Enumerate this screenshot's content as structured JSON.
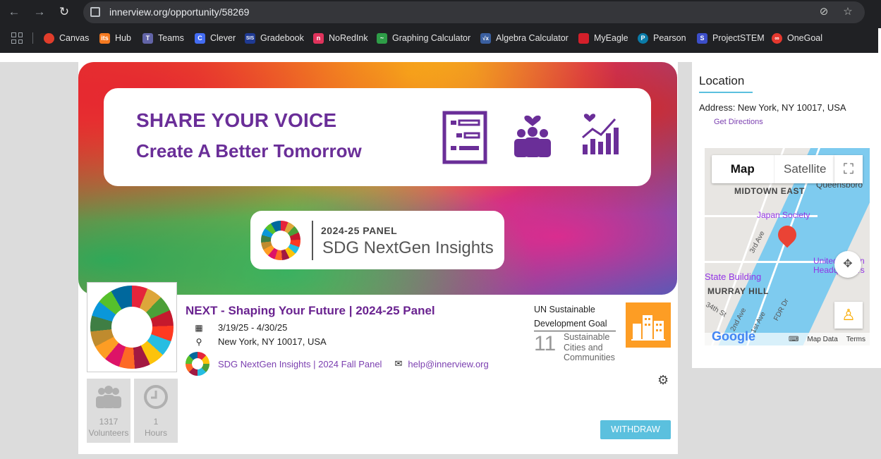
{
  "browser": {
    "url": "innerview.org/opportunity/58269",
    "bookmarks": [
      {
        "label": "Canvas",
        "color": "#e13d2b"
      },
      {
        "label": "Hub",
        "color": "#f47920"
      },
      {
        "label": "Teams",
        "color": "#6264a7"
      },
      {
        "label": "Clever",
        "color": "#436cf2"
      },
      {
        "label": "Gradebook",
        "color": "#1f3a93"
      },
      {
        "label": "NoRedInk",
        "color": "#e0335c"
      },
      {
        "label": "Graphing Calculator",
        "color": "#2e9d47"
      },
      {
        "label": "Algebra Calculator",
        "color": "#3a5f9f"
      },
      {
        "label": "MyEagle",
        "color": "#d41f2a"
      },
      {
        "label": "Pearson",
        "color": "#0a7ba8"
      },
      {
        "label": "ProjectSTEM",
        "color": "#3c4ec9"
      },
      {
        "label": "OneGoal",
        "color": "#e5382e"
      }
    ]
  },
  "banner": {
    "line1": "SHARE YOUR VOICE",
    "line2": "Create A Better Tomorrow",
    "panel_year": "2024-25  PANEL",
    "panel_name": "SDG NextGen Insights"
  },
  "opportunity": {
    "title": "NEXT - Shaping Your Future | 2024-25 Panel",
    "dates": "3/19/25 - 4/30/25",
    "location": "New York, NY 10017, USA",
    "org_link": "SDG NextGen Insights | 2024 Fall Panel",
    "email": "help@innerview.org",
    "volunteers": "1317",
    "volunteers_label": "Volunteers",
    "hours": "1",
    "hours_label": "Hours",
    "withdraw_label": "WITHDRAW"
  },
  "sdg": {
    "label": "UN Sustainable Development Goal",
    "number": "11",
    "name": "Sustainable Cities and Communities",
    "color": "#fd9d24"
  },
  "location": {
    "title": "Location",
    "address": "Address: New York, NY 10017, USA",
    "directions": "Get Directions"
  },
  "map": {
    "map_tab": "Map",
    "satellite_tab": "Satellite",
    "labels": {
      "midtown": "MIDTOWN EAST",
      "queensboro": "Queensboro",
      "japan": "Japan Society",
      "state": "State Building",
      "murray": "MURRAY HILL",
      "united": "United Nation Headquarters",
      "third": "3rd Ave",
      "first": "1st Ave",
      "fdr": "FDR Dr",
      "thirtyfourth": "34th St",
      "second": "2nd Ave"
    },
    "map_data": "Map Data",
    "terms": "Terms",
    "brand": "Google"
  }
}
